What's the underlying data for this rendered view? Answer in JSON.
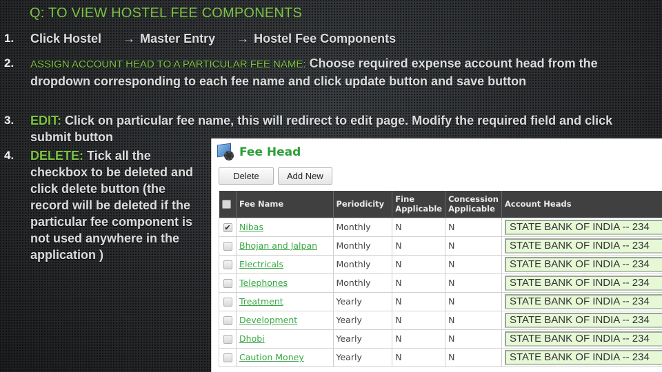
{
  "slide": {
    "title": "Q: TO VIEW HOSTEL FEE COMPONENTS",
    "steps": [
      {
        "num": "1.",
        "path": [
          "Click Hostel",
          "Master Entry",
          "Hostel Fee Components"
        ],
        "arrow": "→"
      },
      {
        "num": "2.",
        "heading": "Assign Account Head To a Particular Fee Name:",
        "text": "Choose required expense account head from the dropdown corresponding to each fee name and click update button and save button"
      },
      {
        "num": "3.",
        "heading": "EDIT:",
        "text": "Click on particular fee name, this will redirect to edit page.   Modify the required field and click submit button"
      },
      {
        "num": "4.",
        "heading": "DELETE:",
        "text": "Tick all the checkbox to be deleted and click delete button (the record will be deleted if the particular fee component is not used anywhere in the application )"
      }
    ]
  },
  "app": {
    "title": "Fee Head",
    "icon": "settings-monitor-icon",
    "buttons": {
      "delete": "Delete",
      "add_new": "Add New"
    },
    "table": {
      "headers": {
        "fee_name": "Fee Name",
        "periodicity": "Periodicity",
        "fine_applicable": "Fine Applicable",
        "concession_applicable": "Concession Applicable",
        "account_heads": "Account Heads"
      },
      "rows": [
        {
          "checked": true,
          "fee_name": "Nibas",
          "periodicity": "Monthly",
          "fine": "N",
          "concession": "N",
          "account_head": "STATE BANK OF INDIA -- 234"
        },
        {
          "checked": false,
          "fee_name": "Bhojan and Jalpan",
          "periodicity": "Monthly",
          "fine": "N",
          "concession": "N",
          "account_head": "STATE BANK OF INDIA -- 234"
        },
        {
          "checked": false,
          "fee_name": "Electricals",
          "periodicity": "Monthly",
          "fine": "N",
          "concession": "N",
          "account_head": "STATE BANK OF INDIA -- 234"
        },
        {
          "checked": false,
          "fee_name": "Telephones",
          "periodicity": "Monthly",
          "fine": "N",
          "concession": "N",
          "account_head": "STATE BANK OF INDIA -- 234"
        },
        {
          "checked": false,
          "fee_name": "Treatment",
          "periodicity": "Yearly",
          "fine": "N",
          "concession": "N",
          "account_head": "STATE BANK OF INDIA -- 234"
        },
        {
          "checked": false,
          "fee_name": "Development",
          "periodicity": "Yearly",
          "fine": "N",
          "concession": "N",
          "account_head": "STATE BANK OF INDIA -- 234"
        },
        {
          "checked": false,
          "fee_name": "Dhobi",
          "periodicity": "Yearly",
          "fine": "N",
          "concession": "N",
          "account_head": "STATE BANK OF INDIA -- 234"
        },
        {
          "checked": false,
          "fee_name": "Caution Money",
          "periodicity": "Yearly",
          "fine": "N",
          "concession": "N",
          "account_head": "STATE BANK OF INDIA -- 234"
        }
      ]
    }
  },
  "colors": {
    "accent_green": "#7cc242",
    "link_green": "#39a845",
    "header_dark": "#404040",
    "select_bg": "#e6f8d6"
  }
}
